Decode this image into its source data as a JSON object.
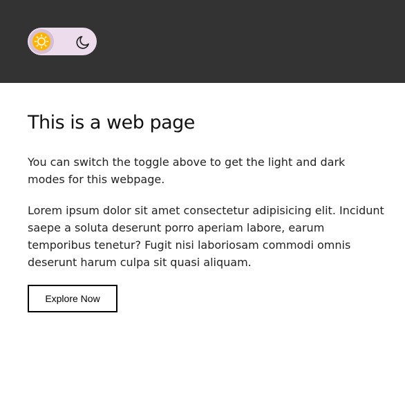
{
  "header": {
    "background": "#333333",
    "toggle": {
      "mode": "light",
      "left_icon": "sun-icon",
      "right_icon": "moon-icon",
      "track_color": "#ecdcec",
      "sun_color": "#ffb300"
    }
  },
  "main": {
    "title": "This is a web page",
    "intro": "You can switch the toggle above to get the light and dark modes for this webpage.",
    "body": "Lorem ipsum dolor sit amet consectetur adipisicing elit. Incidunt saepe a soluta deserunt porro aperiam labore, earum temporibus tenetur? Fugit nisi laboriosam commodi omnis deserunt harum culpa sit quasi aliquam.",
    "button_label": "Explore Now"
  }
}
